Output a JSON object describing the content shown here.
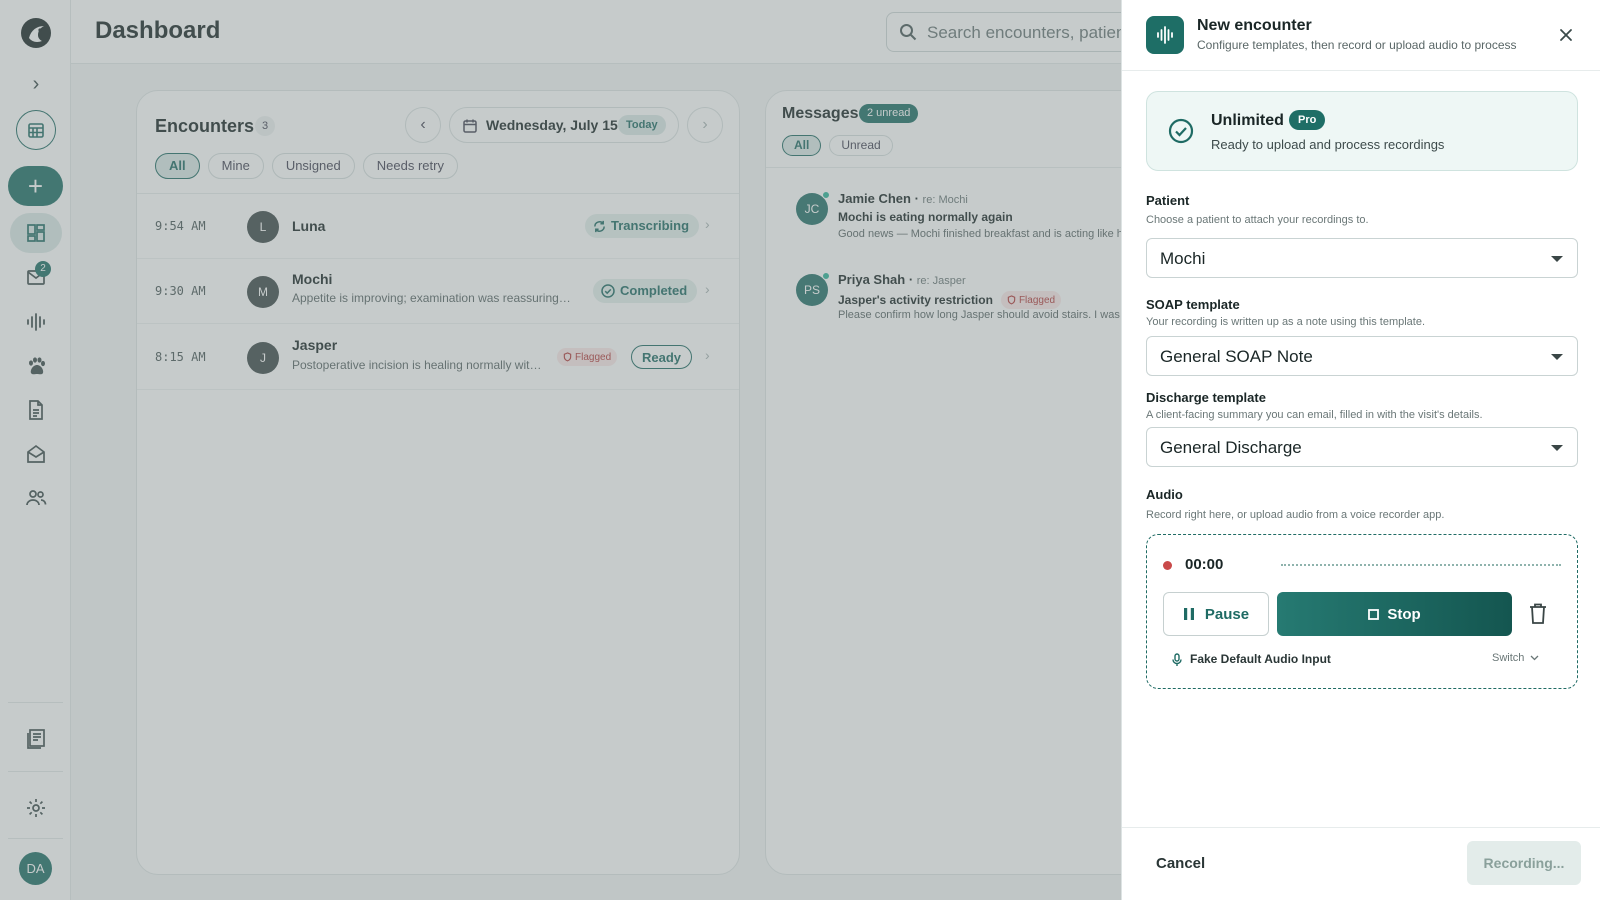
{
  "header": {
    "title": "Dashboard",
    "search_placeholder": "Search encounters, patients..."
  },
  "sidebar": {
    "messages_badge": "2",
    "avatar_initials": "DA"
  },
  "encounters": {
    "title": "Encounters",
    "count": "3",
    "date": "Wednesday, July 15",
    "today_label": "Today",
    "filters": [
      "All",
      "Mine",
      "Unsigned",
      "Needs retry"
    ],
    "rows": [
      {
        "time": "9:54 AM",
        "initial": "L",
        "name": "Luna",
        "summary": "",
        "status": "Transcribing",
        "flag": ""
      },
      {
        "time": "9:30 AM",
        "initial": "M",
        "name": "Mochi",
        "summary": "Appetite is improving; examination was reassuring and no new concerns were noted.",
        "status": "Completed",
        "flag": ""
      },
      {
        "time": "8:15 AM",
        "initial": "J",
        "name": "Jasper",
        "summary": "Postoperative incision is healing normally with no signs of infection.",
        "status": "Ready",
        "flag": "Flagged"
      }
    ]
  },
  "messages": {
    "title": "Messages",
    "unread_pill": "2 unread",
    "filters": [
      "All",
      "Unread"
    ],
    "items": [
      {
        "initials": "JC",
        "from": "Jamie Chen",
        "re": "re: Mochi",
        "subject": "Mochi is eating normally again",
        "flag": "",
        "preview": "Good news — Mochi finished breakfast and is acting like herself again."
      },
      {
        "initials": "PS",
        "from": "Priya Shah",
        "re": "re: Jasper",
        "subject": "Jasper's activity restriction",
        "flag": "Flagged",
        "preview": "Please confirm how long Jasper should avoid stairs. I was told two weeks."
      }
    ]
  },
  "drawer": {
    "title": "New encounter",
    "subtitle": "Configure templates, then record or upload audio to process",
    "plan": {
      "title": "Unlimited",
      "badge": "Pro",
      "subtitle": "Ready to upload and process recordings"
    },
    "patient": {
      "label": "Patient",
      "help": "Choose a patient to attach your recordings to.",
      "value": "Mochi"
    },
    "soap": {
      "label": "SOAP template",
      "help": "Your recording is written up as a note using this template.",
      "value": "General SOAP Note"
    },
    "discharge": {
      "label": "Discharge template",
      "help": "A client-facing summary you can email, filled in with the visit's details.",
      "value": "General Discharge"
    },
    "audio": {
      "label": "Audio",
      "help": "Record right here, or upload audio from a voice recorder app.",
      "timer": "00:00",
      "pause_label": "Pause",
      "stop_label": "Stop",
      "device": "Fake Default Audio Input",
      "switch_label": "Switch"
    },
    "footer": {
      "cancel_label": "Cancel",
      "submit_label": "Recording..."
    }
  },
  "colors": {
    "accent": "#1e6e66",
    "accent_light": "#dbe9e7",
    "flag": "#b43b3b",
    "record": "#c94a4a"
  }
}
